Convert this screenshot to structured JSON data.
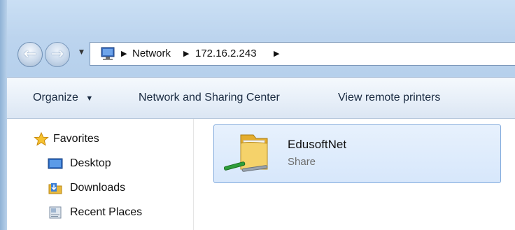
{
  "address": {
    "crumbs": [
      "Network",
      "172.16.2.243"
    ]
  },
  "toolbar": {
    "organize": "Organize",
    "network_sharing": "Network and Sharing Center",
    "remote_printers": "View remote printers"
  },
  "nav": {
    "favorites": "Favorites",
    "items": [
      "Desktop",
      "Downloads",
      "Recent Places"
    ]
  },
  "content": {
    "items": [
      {
        "name": "EdusoftNet",
        "type": "Share"
      }
    ]
  },
  "colors": {
    "title_bg": "#bcd4ee",
    "selection_bg": "#dde9fb",
    "selection_border": "#84acdd",
    "folder": "#f2c94c"
  },
  "icons": {
    "back": "back-arrow-icon",
    "forward": "forward-arrow-icon",
    "address": "network-computer-icon",
    "favorites": "star-icon",
    "desktop": "desktop-icon",
    "downloads": "downloads-folder-icon",
    "recent": "recent-places-icon",
    "share": "network-share-folder-icon"
  }
}
